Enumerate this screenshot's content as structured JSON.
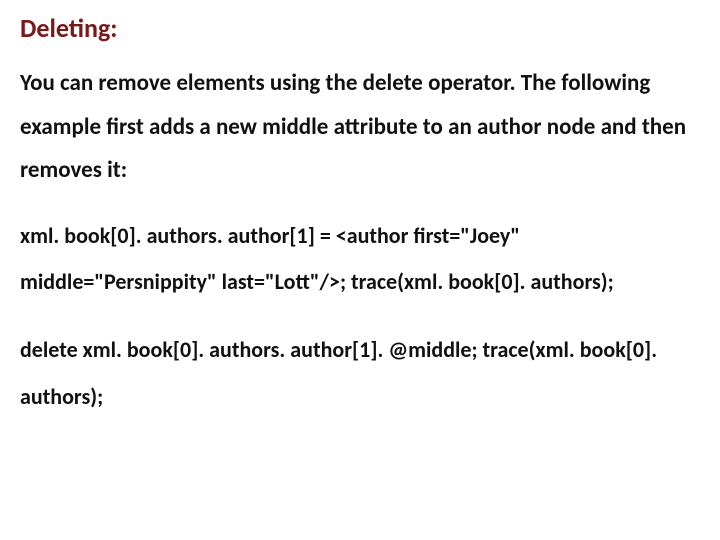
{
  "heading": "Deleting:",
  "intro": "You can remove elements using the delete operator. The following example first adds a new middle attribute to an author node and then removes it:",
  "code1": "xml. book[0]. authors. author[1] = <author first=\"Joey\" middle=\"Persnippity\" last=\"Lott\"/>; trace(xml. book[0]. authors);",
  "code2": "delete xml. book[0]. authors. author[1]. @middle; trace(xml. book[0]. authors);"
}
